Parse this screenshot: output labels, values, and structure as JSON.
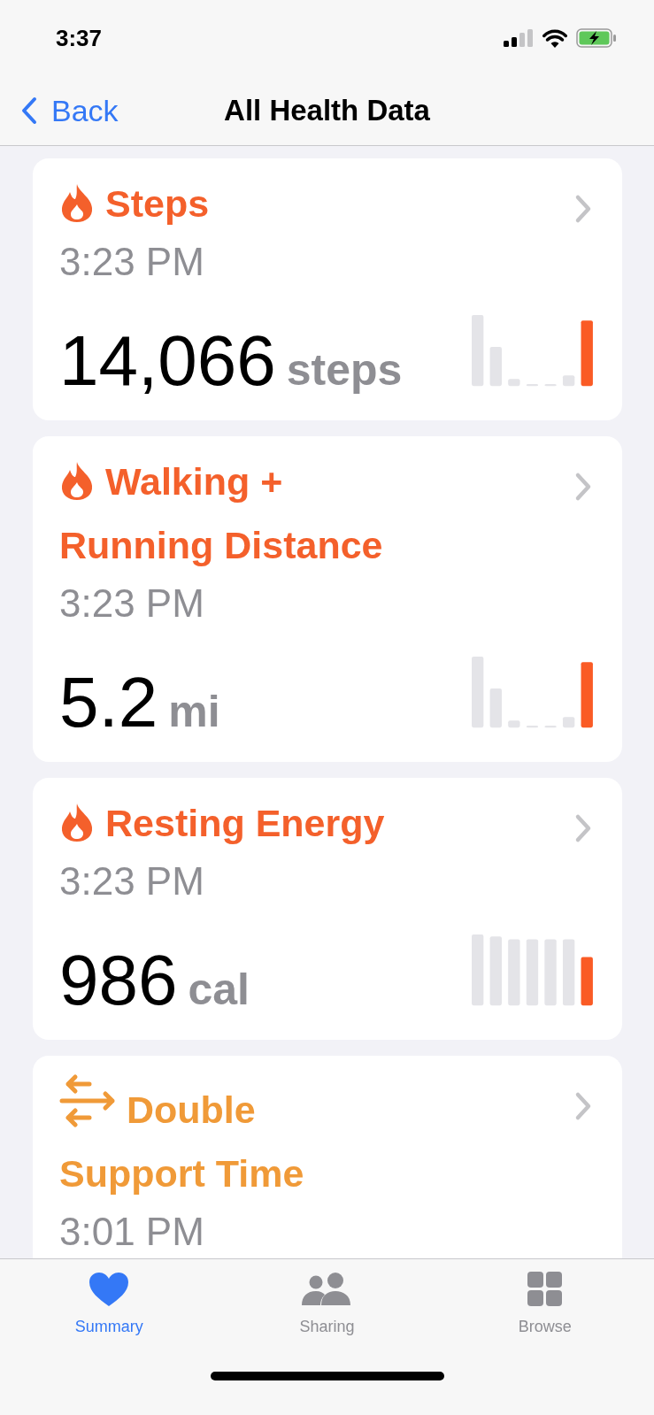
{
  "status_bar": {
    "time": "3:37"
  },
  "nav": {
    "back": "Back",
    "title": "All Health Data"
  },
  "cards": [
    {
      "kind": "flame",
      "color": "#f4602b",
      "title": "Steps",
      "time": "3:23 PM",
      "value": "14,066",
      "unit": "steps"
    },
    {
      "kind": "flame",
      "color": "#f4602b",
      "title": "Walking + Running Distance",
      "time": "3:23 PM",
      "value": "5.2",
      "unit": "mi"
    },
    {
      "kind": "flame",
      "color": "#f4602b",
      "title": "Resting Energy",
      "time": "3:23 PM",
      "value": "986",
      "unit": "cal"
    },
    {
      "kind": "arrows",
      "color": "#f09a38",
      "title": "Double Support Time",
      "time": "3:01 PM"
    }
  ],
  "tabs": [
    {
      "kind": "heart",
      "label": "Summary",
      "selected": true
    },
    {
      "kind": "people",
      "label": "Sharing",
      "selected": false
    },
    {
      "kind": "grid",
      "label": "Browse",
      "selected": false
    }
  ]
}
